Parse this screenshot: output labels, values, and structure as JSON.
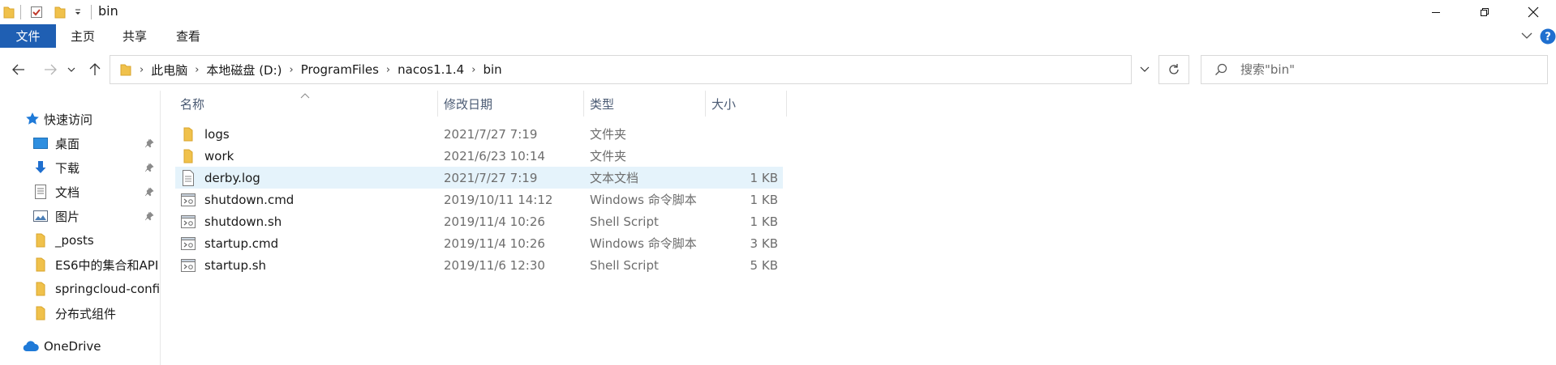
{
  "window": {
    "title": "bin",
    "controls": {
      "minimize": "minimize-icon",
      "restore": "restore-icon",
      "close": "close-icon"
    }
  },
  "quick_access_toolbar": {
    "icons": [
      "folder-icon",
      "properties-checkbox-icon",
      "new-folder-icon",
      "customize-dropdown-icon"
    ]
  },
  "ribbon": {
    "tabs": [
      {
        "label": "文件",
        "active": true
      },
      {
        "label": "主页"
      },
      {
        "label": "共享"
      },
      {
        "label": "查看"
      }
    ],
    "expand_icon": "chevron-down-icon",
    "help_icon": "help-icon"
  },
  "address_bar": {
    "breadcrumbs": [
      "此电脑",
      "本地磁盘 (D:)",
      "ProgramFiles",
      "nacos1.1.4",
      "bin"
    ],
    "search_placeholder": "搜索\"bin\""
  },
  "navigation_pane": {
    "items": [
      {
        "label": "快速访问",
        "icon": "star-icon",
        "level": 0
      },
      {
        "label": "桌面",
        "icon": "desktop-icon",
        "level": 1,
        "pinned": true
      },
      {
        "label": "下载",
        "icon": "download-arrow-icon",
        "level": 1,
        "pinned": true
      },
      {
        "label": "文档",
        "icon": "document-icon",
        "level": 1,
        "pinned": true
      },
      {
        "label": "图片",
        "icon": "picture-icon",
        "level": 1,
        "pinned": true
      },
      {
        "label": "_posts",
        "icon": "folder-icon",
        "level": 1
      },
      {
        "label": "ES6中的集合和API",
        "icon": "folder-icon",
        "level": 1
      },
      {
        "label": "springcloud-confi",
        "icon": "folder-icon",
        "level": 1
      },
      {
        "label": "分布式组件",
        "icon": "folder-icon",
        "level": 1
      },
      {
        "label": "OneDrive",
        "icon": "cloud-icon",
        "level": 0
      }
    ]
  },
  "file_list": {
    "columns": [
      "名称",
      "修改日期",
      "类型",
      "大小"
    ],
    "rows": [
      {
        "name": "logs",
        "date": "2021/7/27 7:19",
        "type": "文件夹",
        "size": "",
        "icon": "folder-icon"
      },
      {
        "name": "work",
        "date": "2021/6/23 10:14",
        "type": "文件夹",
        "size": "",
        "icon": "folder-icon"
      },
      {
        "name": "derby.log",
        "date": "2021/7/27 7:19",
        "type": "文本文档",
        "size": "1 KB",
        "icon": "text-file-icon",
        "selected": true
      },
      {
        "name": "shutdown.cmd",
        "date": "2019/10/11 14:12",
        "type": "Windows 命令脚本",
        "size": "1 KB",
        "icon": "script-file-icon"
      },
      {
        "name": "shutdown.sh",
        "date": "2019/11/4 10:26",
        "type": "Shell Script",
        "size": "1 KB",
        "icon": "script-file-icon"
      },
      {
        "name": "startup.cmd",
        "date": "2019/11/4 10:26",
        "type": "Windows 命令脚本",
        "size": "3 KB",
        "icon": "script-file-icon"
      },
      {
        "name": "startup.sh",
        "date": "2019/11/6 12:30",
        "type": "Shell Script",
        "size": "5 KB",
        "icon": "script-file-icon"
      }
    ]
  },
  "colors": {
    "file_tab": "#1f5fb3",
    "selection": "#e5f3fb",
    "folder": "#f0c14b",
    "header_text": "#4a5a73"
  }
}
